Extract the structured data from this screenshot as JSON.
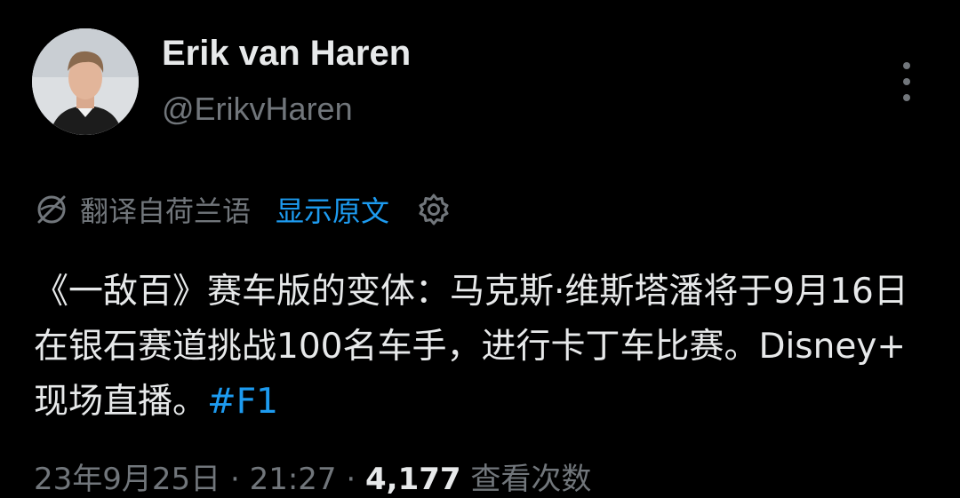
{
  "author": {
    "name": "Erik van Haren",
    "handle": "@ErikvHaren"
  },
  "translation": {
    "label": "翻译自荷兰语",
    "show_original": "显示原文"
  },
  "tweet": {
    "text": "《一敌百》赛车版的变体：马克斯·维斯塔潘将于9月16日在银石赛道挑战100名车手，进行卡丁车比赛。Disney+ 现场直播。",
    "hashtag": "#F1"
  },
  "meta": {
    "date": "23年9月25日 · 21:27 · ",
    "views_count": "4,177",
    "views_label": " 查看次数"
  },
  "icons": {
    "more": "more-vertical-icon",
    "translate": "translate-globe-icon",
    "settings": "gear-icon"
  },
  "colors": {
    "background": "#000000",
    "text": "#e7e9ea",
    "muted": "#71767b",
    "accent": "#1d9bf0"
  }
}
